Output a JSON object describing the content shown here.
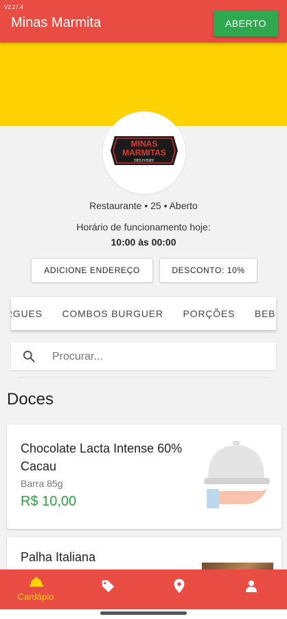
{
  "app": {
    "version": "V2.27.4",
    "title": "Minas Marmita",
    "status_button": "ABERTO"
  },
  "restaurant": {
    "logo_text": {
      "line1": "MINAS",
      "line2": "MARMITAS",
      "line3": "DELIVERY"
    },
    "meta": "Restaurante • 25 • Aberto",
    "hours_label": "Horário de funcionamento hoje:",
    "hours_value": "10:00 às 00:00"
  },
  "actions": {
    "address": "ADICIONE ENDEREÇO",
    "discount": "DESCONTO: 10%"
  },
  "categories": [
    "RGUES",
    "COMBOS BURGUER",
    "PORÇÕES",
    "BEBIDAS"
  ],
  "search": {
    "placeholder": "Procurar..."
  },
  "section": {
    "title": "Doces"
  },
  "products": [
    {
      "name": "Chocolate Lacta Intense 60% Cacau",
      "desc": "Barra 85g",
      "price": "R$ 10,00"
    },
    {
      "name": "Palha Italiana"
    }
  ],
  "bottom_nav": {
    "menu_label": "Cardápio"
  },
  "colors": {
    "primary": "#e84c43",
    "banner": "#fed203",
    "accent_green": "#2fa84f",
    "price_green": "#2ea043"
  },
  "icons": [
    "search-icon",
    "cloche-icon",
    "cardapio-icon",
    "tag-icon",
    "location-icon",
    "user-icon"
  ]
}
